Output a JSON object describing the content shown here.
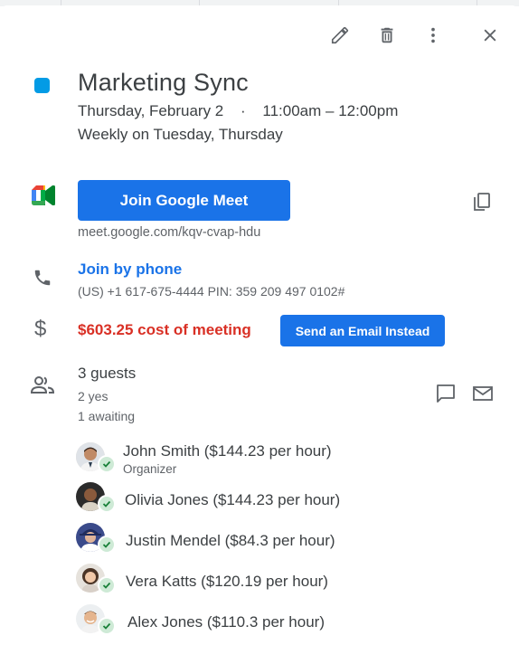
{
  "event": {
    "title": "Marketing Sync",
    "color": "#039be5",
    "date": "Thursday, February 2",
    "separator": "·",
    "time": "11:00am – 12:00pm",
    "recurrence": "Weekly on Tuesday, Thursday"
  },
  "toolbar": {
    "icons": [
      "edit-icon",
      "delete-icon",
      "more-options-icon",
      "close-icon"
    ]
  },
  "meet": {
    "button_label": "Join Google Meet",
    "link": "meet.google.com/kqv-cvap-hdu"
  },
  "phone": {
    "label": "Join by phone",
    "details": "(US) +1 617-675-4444 PIN: 359 209 497 0102#"
  },
  "cost": {
    "text": "$603.25 cost of meeting",
    "button_label": "Send an Email Instead",
    "icon_text": "$"
  },
  "guests_summary": {
    "count": "3 guests",
    "yes": "2 yes",
    "awaiting": "1 awaiting"
  },
  "guests": [
    {
      "name": "John Smith ($144.23 per hour)",
      "role": "Organizer"
    },
    {
      "name": "Olivia Jones ($144.23 per hour)",
      "role": ""
    },
    {
      "name": "Justin Mendel ($84.3 per hour)",
      "role": ""
    },
    {
      "name": "Vera Katts ($120.19 per hour)",
      "role": ""
    },
    {
      "name": "Alex Jones ($110.3 per hour)",
      "role": ""
    }
  ],
  "colors": {
    "accent": "#1a73e8",
    "cost_red": "#d93025",
    "check_bg": "#ceead6",
    "check_fg": "#188038"
  }
}
